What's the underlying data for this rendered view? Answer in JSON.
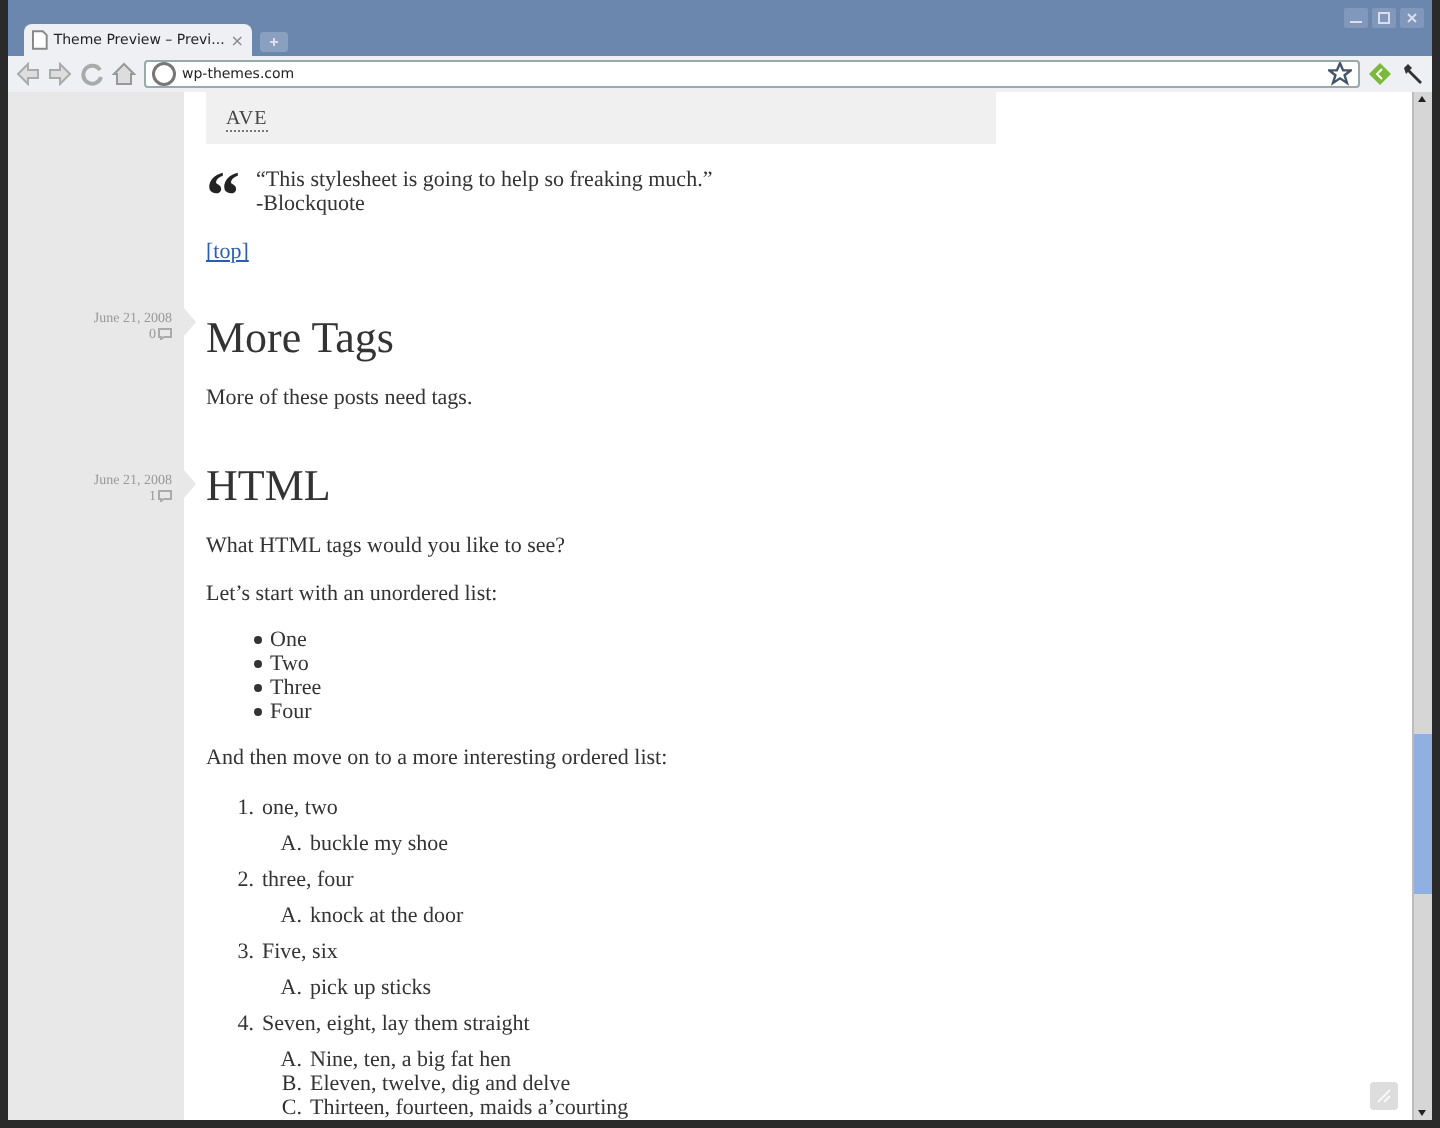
{
  "window": {
    "tab": {
      "title": "Theme Preview – Previ...",
      "close": "×",
      "selected": true
    },
    "address": "wp-themes.com"
  },
  "page": {
    "top_box": {
      "abbr": "AVE"
    },
    "blockquote": {
      "mark": "“",
      "lines": [
        "“This stylesheet is going to help so freaking much.”",
        "-Blockquote"
      ]
    },
    "top_link": "[top]",
    "posts": [
      {
        "date": "June 21, 2008",
        "comments": "0",
        "title": "More Tags",
        "blocks": [
          {
            "kind": "paragraph",
            "text": "More of these posts need tags."
          }
        ]
      },
      {
        "date": "June 21, 2008",
        "comments": "1",
        "title": "HTML",
        "blocks": [
          {
            "kind": "paragraph",
            "text": "What HTML tags would you like to see?"
          },
          {
            "kind": "paragraph",
            "text": "Let’s start with an unordered list:"
          },
          {
            "kind": "bullets",
            "items": [
              "One",
              "Two",
              "Three",
              "Four"
            ]
          },
          {
            "kind": "paragraph",
            "text": "And then move on to a more interesting ordered list:"
          },
          {
            "kind": "numbered",
            "items": [
              {
                "number": "1.",
                "text": "one, two",
                "children": [
                  {
                    "number": "A.",
                    "text": "buckle my shoe"
                  }
                ]
              },
              {
                "number": "2.",
                "text": "three, four",
                "children": [
                  {
                    "number": "A.",
                    "text": "knock at the door"
                  }
                ]
              },
              {
                "number": "3.",
                "text": "Five, six",
                "children": [
                  {
                    "number": "A.",
                    "text": "pick up sticks"
                  }
                ]
              },
              {
                "number": "4.",
                "text": "Seven, eight, lay them straight",
                "children": [
                  {
                    "number": "A.",
                    "text": "Nine, ten, a big fat hen"
                  },
                  {
                    "number": "B.",
                    "text": "Eleven, twelve, dig and delve"
                  },
                  {
                    "number": "C.",
                    "text": "Thirteen, fourteen, maids a’courting"
                  }
                ]
              }
            ]
          }
        ]
      }
    ]
  }
}
